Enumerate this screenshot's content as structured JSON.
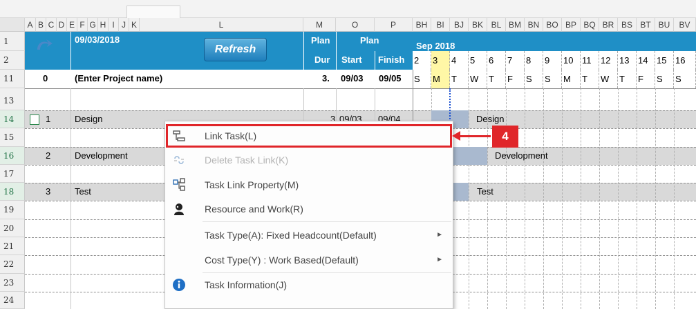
{
  "column_headers": [
    "A",
    "B",
    "C",
    "D",
    "E",
    "F",
    "G",
    "H",
    "I",
    "J",
    "K",
    "L",
    "M",
    "O",
    "P",
    "BH",
    "BI",
    "BJ",
    "BK",
    "BL",
    "BM",
    "BN",
    "BO",
    "BP",
    "BQ",
    "BR",
    "BS",
    "BT",
    "BU",
    "BV"
  ],
  "row_numbers": [
    "1",
    "2",
    "11",
    "13",
    "14",
    "15",
    "16",
    "17",
    "18",
    "19",
    "20",
    "21",
    "22",
    "23",
    "24"
  ],
  "header": {
    "date": "09/03/2018",
    "refresh_label": "Refresh",
    "plan_dur_top": "Plan",
    "plan_dur_bottom": "Dur",
    "plan_group": "Plan",
    "plan_start": "Start",
    "plan_finish": "Finish",
    "month": "Sep 2018",
    "day_numbers": [
      "2",
      "3",
      "4",
      "5",
      "6",
      "7",
      "8",
      "9",
      "10",
      "11",
      "12",
      "13",
      "14",
      "15",
      "16"
    ],
    "weekdays": [
      "S",
      "M",
      "T",
      "W",
      "T",
      "F",
      "S",
      "S",
      "M",
      "T",
      "W",
      "T",
      "F",
      "S",
      "S"
    ]
  },
  "project_row": {
    "id": "0",
    "name": "(Enter Project name)",
    "dur": "3.",
    "start": "09/03",
    "finish": "09/05"
  },
  "tasks": [
    {
      "id": "1",
      "name": "Design",
      "dur": "3",
      "start": "09/03",
      "finish": "09/04",
      "bar_label": "Design"
    },
    {
      "id": "2",
      "name": "Development",
      "bar_label": "Development"
    },
    {
      "id": "3",
      "name": "Test",
      "bar_label": "Test"
    }
  ],
  "context_menu": [
    {
      "label": "Link Task(L)",
      "icon": "link-task-icon",
      "enabled": true,
      "submenu": false
    },
    {
      "label": "Delete Task Link(K)",
      "icon": "unlink-icon",
      "enabled": false,
      "submenu": false
    },
    {
      "label": "Task Link Property(M)",
      "icon": "link-property-icon",
      "enabled": true,
      "submenu": false
    },
    {
      "label": "Resource and Work(R)",
      "icon": "resource-icon",
      "enabled": true,
      "submenu": false
    },
    {
      "label": "Task Type(A): Fixed Headcount(Default)",
      "icon": "",
      "enabled": true,
      "submenu": true
    },
    {
      "label": "Cost Type(Y) : Work Based(Default)",
      "icon": "",
      "enabled": true,
      "submenu": true
    },
    {
      "label": "Task Information(J)",
      "icon": "info-icon",
      "enabled": true,
      "submenu": false
    }
  ],
  "callout": {
    "number": "4"
  },
  "colors": {
    "header_blue": "#1f8fc6",
    "highlight_red": "#e0262a",
    "today_yellow": "#fff7a6",
    "bar_blue": "#a9b9cf"
  }
}
